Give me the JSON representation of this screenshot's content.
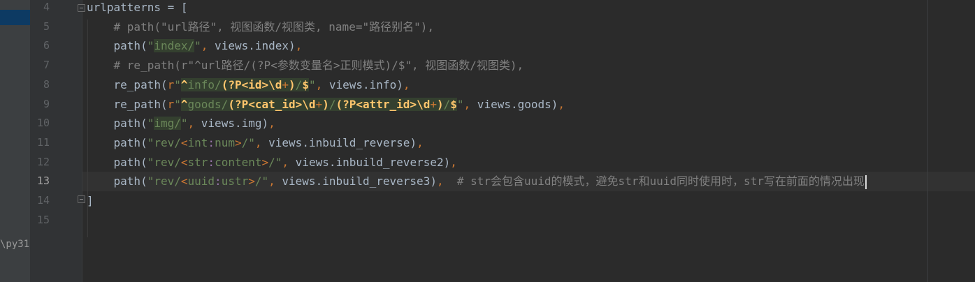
{
  "project_panel": {
    "path_fragment": "\\py31"
  },
  "editor": {
    "line_numbers": [
      "4",
      "5",
      "6",
      "7",
      "8",
      "9",
      "10",
      "11",
      "12",
      "13",
      "14",
      "15"
    ],
    "current_line": "13",
    "lines": [
      {
        "parts": [
          {
            "c": "t-id",
            "t": "urlpatterns = ["
          }
        ]
      },
      {
        "parts": [
          {
            "c": "t-com",
            "t": "    # path(\"url路径\", 视图函数/视图类, name=\"路径别名\"),"
          }
        ]
      },
      {
        "parts": [
          {
            "c": "t-id",
            "t": "    path("
          },
          {
            "c": "t-str",
            "t": "\""
          },
          {
            "c": "t-re",
            "t": "index/"
          },
          {
            "c": "t-str",
            "t": "\""
          },
          {
            "c": "t-kw",
            "t": ","
          },
          {
            "c": "t-id",
            "t": " views.index)"
          },
          {
            "c": "t-kw",
            "t": ","
          }
        ]
      },
      {
        "parts": [
          {
            "c": "t-com",
            "t": "    # re_path(r\"^url路径/(?P<参数变量名>正则模式)/$\", 视图函数/视图类),"
          }
        ]
      },
      {
        "parts": [
          {
            "c": "t-id",
            "t": "    re_path("
          },
          {
            "c": "t-pre",
            "t": "r"
          },
          {
            "c": "t-str",
            "t": "\""
          },
          {
            "c": "t-re-b",
            "t": "^"
          },
          {
            "c": "t-re",
            "t": "info/"
          },
          {
            "c": "t-re-b",
            "t": "(?P<id>\\d"
          },
          {
            "c": "t-re-q",
            "t": "+"
          },
          {
            "c": "t-re-b",
            "t": ")"
          },
          {
            "c": "t-re",
            "t": "/"
          },
          {
            "c": "t-re-b",
            "t": "$"
          },
          {
            "c": "t-str",
            "t": "\""
          },
          {
            "c": "t-kw",
            "t": ","
          },
          {
            "c": "t-id",
            "t": " views.info)"
          },
          {
            "c": "t-kw",
            "t": ","
          }
        ]
      },
      {
        "parts": [
          {
            "c": "t-id",
            "t": "    re_path("
          },
          {
            "c": "t-pre",
            "t": "r"
          },
          {
            "c": "t-str",
            "t": "\""
          },
          {
            "c": "t-re-b",
            "t": "^"
          },
          {
            "c": "t-re",
            "t": "goods/"
          },
          {
            "c": "t-re-b",
            "t": "(?P<cat_id>\\d"
          },
          {
            "c": "t-re-q",
            "t": "+"
          },
          {
            "c": "t-re-b",
            "t": ")"
          },
          {
            "c": "t-re",
            "t": "/"
          },
          {
            "c": "t-re-b",
            "t": "(?P<attr_id>\\d"
          },
          {
            "c": "t-re-q",
            "t": "+"
          },
          {
            "c": "t-re-b",
            "t": ")"
          },
          {
            "c": "t-re",
            "t": "/"
          },
          {
            "c": "t-re-b",
            "t": "$"
          },
          {
            "c": "t-str",
            "t": "\""
          },
          {
            "c": "t-kw",
            "t": ","
          },
          {
            "c": "t-id",
            "t": " views.goods)"
          },
          {
            "c": "t-kw",
            "t": ","
          }
        ]
      },
      {
        "parts": [
          {
            "c": "t-id",
            "t": "    path("
          },
          {
            "c": "t-str",
            "t": "\""
          },
          {
            "c": "t-re",
            "t": "img/"
          },
          {
            "c": "t-str",
            "t": "\""
          },
          {
            "c": "t-kw",
            "t": ","
          },
          {
            "c": "t-id",
            "t": " views.img)"
          },
          {
            "c": "t-kw",
            "t": ","
          }
        ]
      },
      {
        "parts": [
          {
            "c": "t-id",
            "t": "    path("
          },
          {
            "c": "t-str",
            "t": "\"rev/"
          },
          {
            "c": "t-conv",
            "t": "<"
          },
          {
            "c": "t-str",
            "t": "int"
          },
          {
            "c": "t-convn",
            "t": ":"
          },
          {
            "c": "t-str",
            "t": "num"
          },
          {
            "c": "t-conv",
            "t": ">"
          },
          {
            "c": "t-str",
            "t": "/\""
          },
          {
            "c": "t-kw",
            "t": ","
          },
          {
            "c": "t-id",
            "t": " views.inbuild_reverse)"
          },
          {
            "c": "t-kw",
            "t": ","
          }
        ]
      },
      {
        "parts": [
          {
            "c": "t-id",
            "t": "    path("
          },
          {
            "c": "t-str",
            "t": "\"rev/"
          },
          {
            "c": "t-conv",
            "t": "<"
          },
          {
            "c": "t-str",
            "t": "str"
          },
          {
            "c": "t-convn",
            "t": ":"
          },
          {
            "c": "t-str",
            "t": "content"
          },
          {
            "c": "t-conv",
            "t": ">"
          },
          {
            "c": "t-str",
            "t": "/\""
          },
          {
            "c": "t-kw",
            "t": ","
          },
          {
            "c": "t-id",
            "t": " views.inbuild_reverse2)"
          },
          {
            "c": "t-kw",
            "t": ","
          }
        ]
      },
      {
        "parts": [
          {
            "c": "t-id",
            "t": "    path("
          },
          {
            "c": "t-str",
            "t": "\"rev/"
          },
          {
            "c": "t-conv",
            "t": "<"
          },
          {
            "c": "t-str",
            "t": "uuid"
          },
          {
            "c": "t-convn",
            "t": ":"
          },
          {
            "c": "t-str",
            "t": "ustr"
          },
          {
            "c": "t-conv",
            "t": ">"
          },
          {
            "c": "t-str",
            "t": "/\""
          },
          {
            "c": "t-kw",
            "t": ","
          },
          {
            "c": "t-id",
            "t": " views.inbuild_reverse3)"
          },
          {
            "c": "t-kw",
            "t": ","
          },
          {
            "c": "t-com",
            "t": "  # str会包含uuid的模式，避免str和uuid同时使用时，str写在前面的情况出现"
          }
        ],
        "caret": true
      },
      {
        "parts": [
          {
            "c": "t-id",
            "t": "]"
          }
        ]
      },
      {
        "parts": []
      }
    ]
  },
  "colors": {
    "background": "#2b2b2b",
    "gutter": "#313335",
    "keyword": "#cc7832",
    "string": "#6a8759",
    "comment": "#808080",
    "regex_group": "#ffc66d",
    "identifier": "#a9b7c6"
  }
}
